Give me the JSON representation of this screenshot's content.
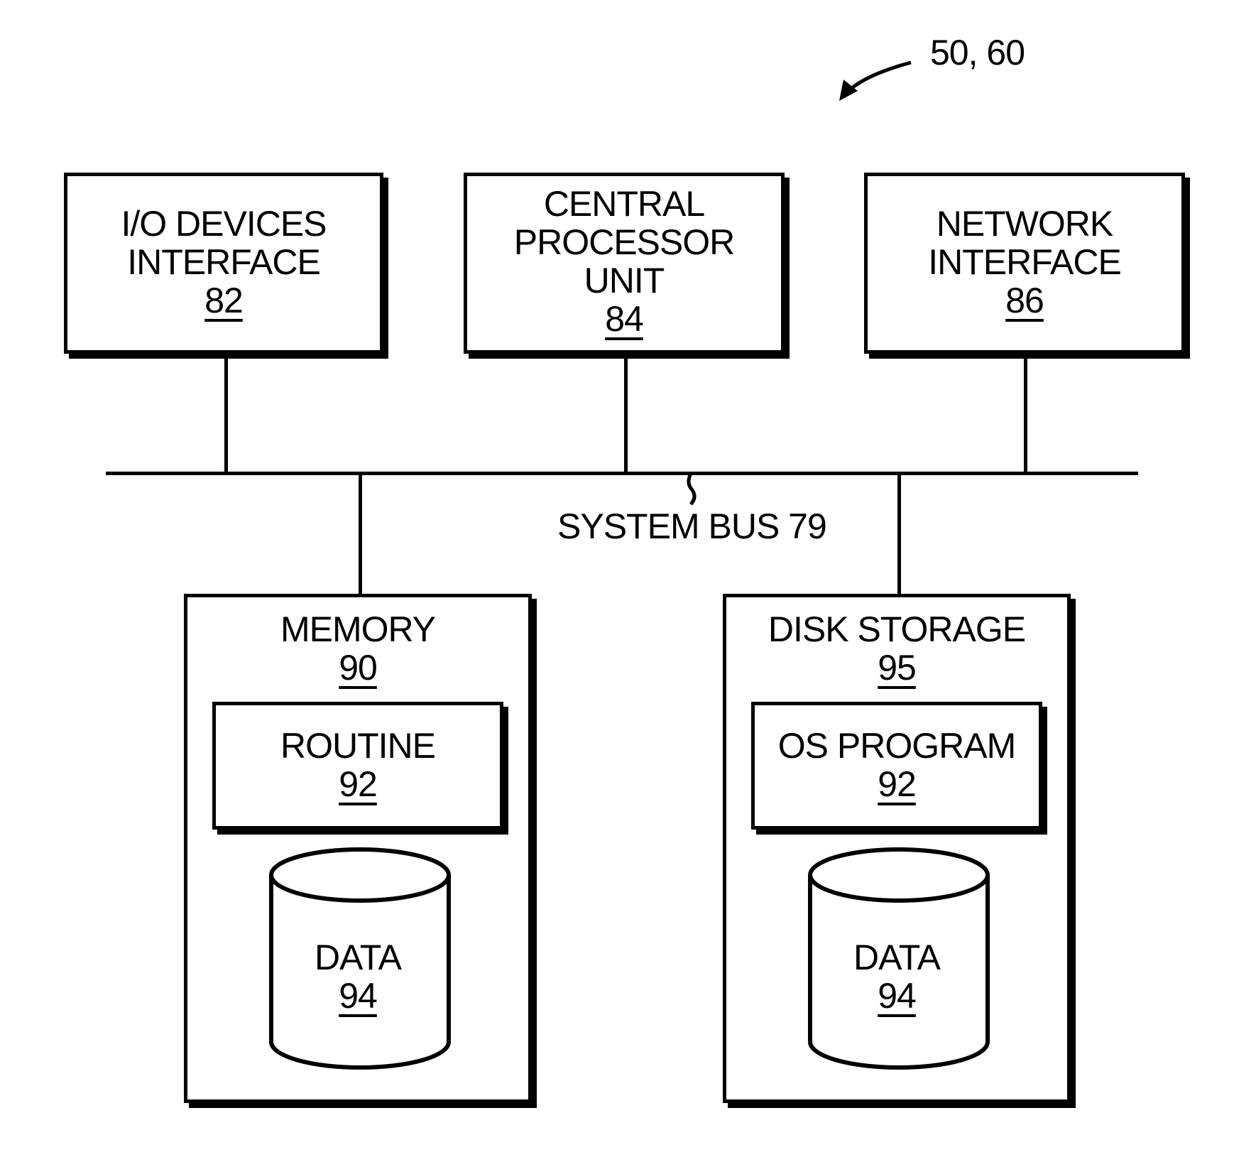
{
  "figure_ref": "50, 60",
  "top_components": [
    {
      "id": "io",
      "lines": [
        "I/O DEVICES",
        "INTERFACE"
      ],
      "ref": "82"
    },
    {
      "id": "cpu",
      "lines": [
        "CENTRAL",
        "PROCESSOR",
        "UNIT"
      ],
      "ref": "84"
    },
    {
      "id": "net",
      "lines": [
        "NETWORK",
        "INTERFACE"
      ],
      "ref": "86"
    }
  ],
  "bus": {
    "label": "SYSTEM BUS 79"
  },
  "memory": {
    "title": "MEMORY",
    "ref": "90",
    "inner": {
      "label": "ROUTINE",
      "ref": "92"
    },
    "data": {
      "label": "DATA",
      "ref": "94"
    }
  },
  "disk": {
    "title": "DISK STORAGE",
    "ref": "95",
    "inner": {
      "label": "OS PROGRAM",
      "ref": "92"
    },
    "data": {
      "label": "DATA",
      "ref": "94"
    }
  }
}
